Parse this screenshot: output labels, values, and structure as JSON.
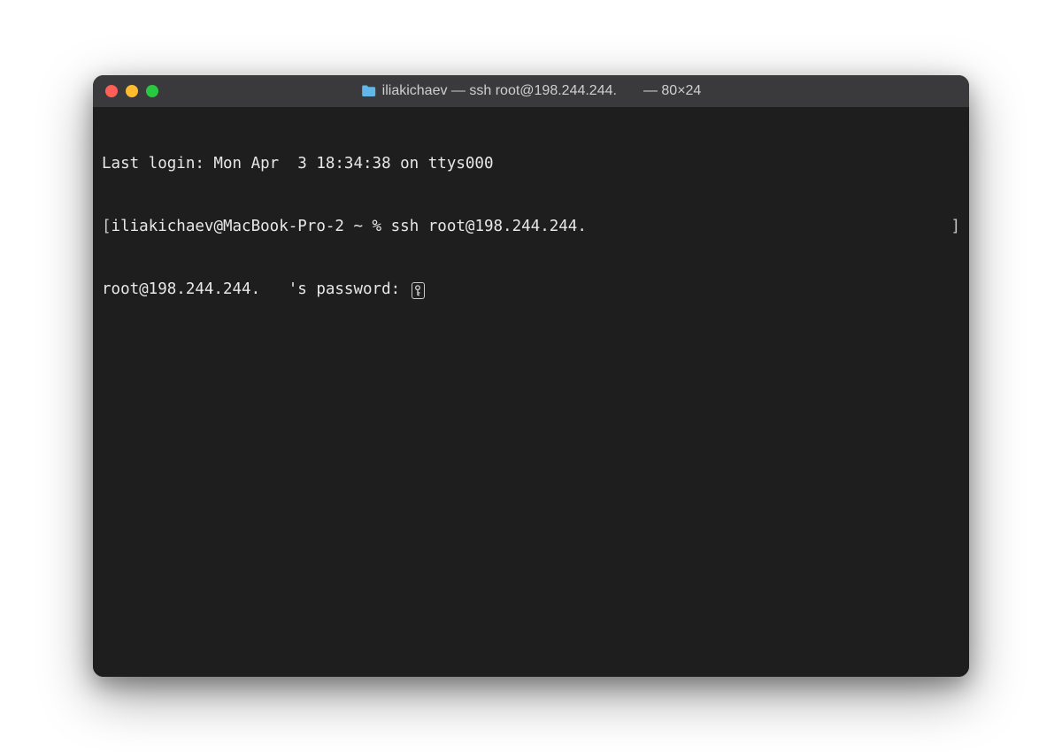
{
  "window": {
    "title_main": "iliakichaev — ssh root@198.244.244.",
    "title_size": "— 80×24"
  },
  "terminal": {
    "last_login": "Last login: Mon Apr  3 18:34:38 on ttys000",
    "prompt_open": "[",
    "prompt_user_host": "iliakichaev@MacBook-Pro-2 ~ % ",
    "command": "ssh root@198.244.244.",
    "prompt_close": "]",
    "password_prompt": "root@198.244.244.   's password: "
  }
}
